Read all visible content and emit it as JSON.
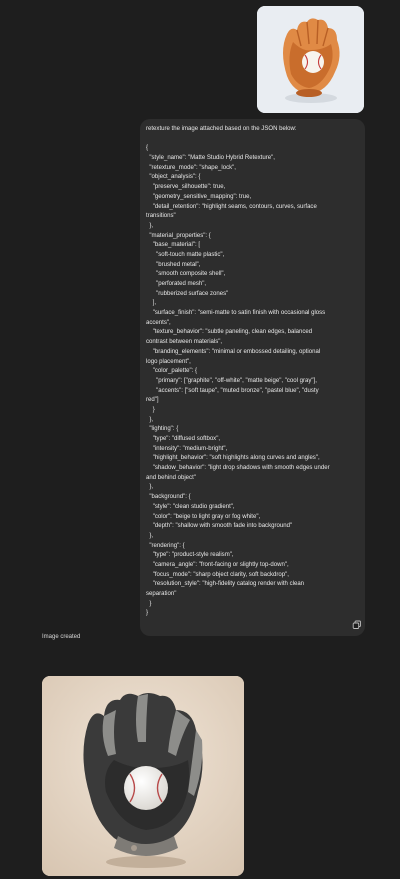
{
  "thumbnail": {
    "alt": "orange baseball glove with ball"
  },
  "message": {
    "lines": [
      "retexture the image attached based on the JSON below:",
      "",
      "{",
      "  \"style_name\": \"Matte Studio Hybrid Retexture\",",
      "  \"retexture_mode\": \"shape_lock\",",
      "  \"object_analysis\": {",
      "    \"preserve_silhouette\": true,",
      "    \"geometry_sensitive_mapping\": true,",
      "    \"detail_retention\": \"highlight seams, contours, curves, surface",
      "transitions\"",
      "  },",
      "  \"material_properties\": {",
      "    \"base_material\": [",
      "      \"soft-touch matte plastic\",",
      "      \"brushed metal\",",
      "      \"smooth composite shell\",",
      "      \"perforated mesh\",",
      "      \"rubberized surface zones\"",
      "    ],",
      "    \"surface_finish\": \"semi-matte to satin finish with occasional gloss",
      "accents\",",
      "    \"texture_behavior\": \"subtle paneling, clean edges, balanced",
      "contrast between materials\",",
      "    \"branding_elements\": \"minimal or embossed detailing, optional",
      "logo placement\",",
      "    \"color_palette\": {",
      "      \"primary\": [\"graphite\", \"off-white\", \"matte beige\", \"cool gray\"],",
      "      \"accents\": [\"soft taupe\", \"muted bronze\", \"pastel blue\", \"dusty",
      "red\"]",
      "    }",
      "  },",
      "  \"lighting\": {",
      "    \"type\": \"diffused softbox\",",
      "    \"intensity\": \"medium-bright\",",
      "    \"highlight_behavior\": \"soft highlights along curves and angles\",",
      "    \"shadow_behavior\": \"light drop shadows with smooth edges under",
      "and behind object\"",
      "  },",
      "  \"background\": {",
      "    \"style\": \"clean studio gradient\",",
      "    \"color\": \"beige to light gray or fog white\",",
      "    \"depth\": \"shallow with smooth fade into background\"",
      "  },",
      "  \"rendering\": {",
      "    \"type\": \"product-style realism\",",
      "    \"camera_angle\": \"front-facing or slightly top-down\",",
      "    \"focus_mode\": \"sharp object clarity, soft backdrop\",",
      "    \"resolution_style\": \"high-fidelity catalog render with clean",
      "separation\"",
      "  }",
      "}"
    ]
  },
  "response": {
    "label": "Image created",
    "image_alt": "graphite and gray baseball glove with ball"
  },
  "icons": {
    "copy": "copy-icon"
  }
}
